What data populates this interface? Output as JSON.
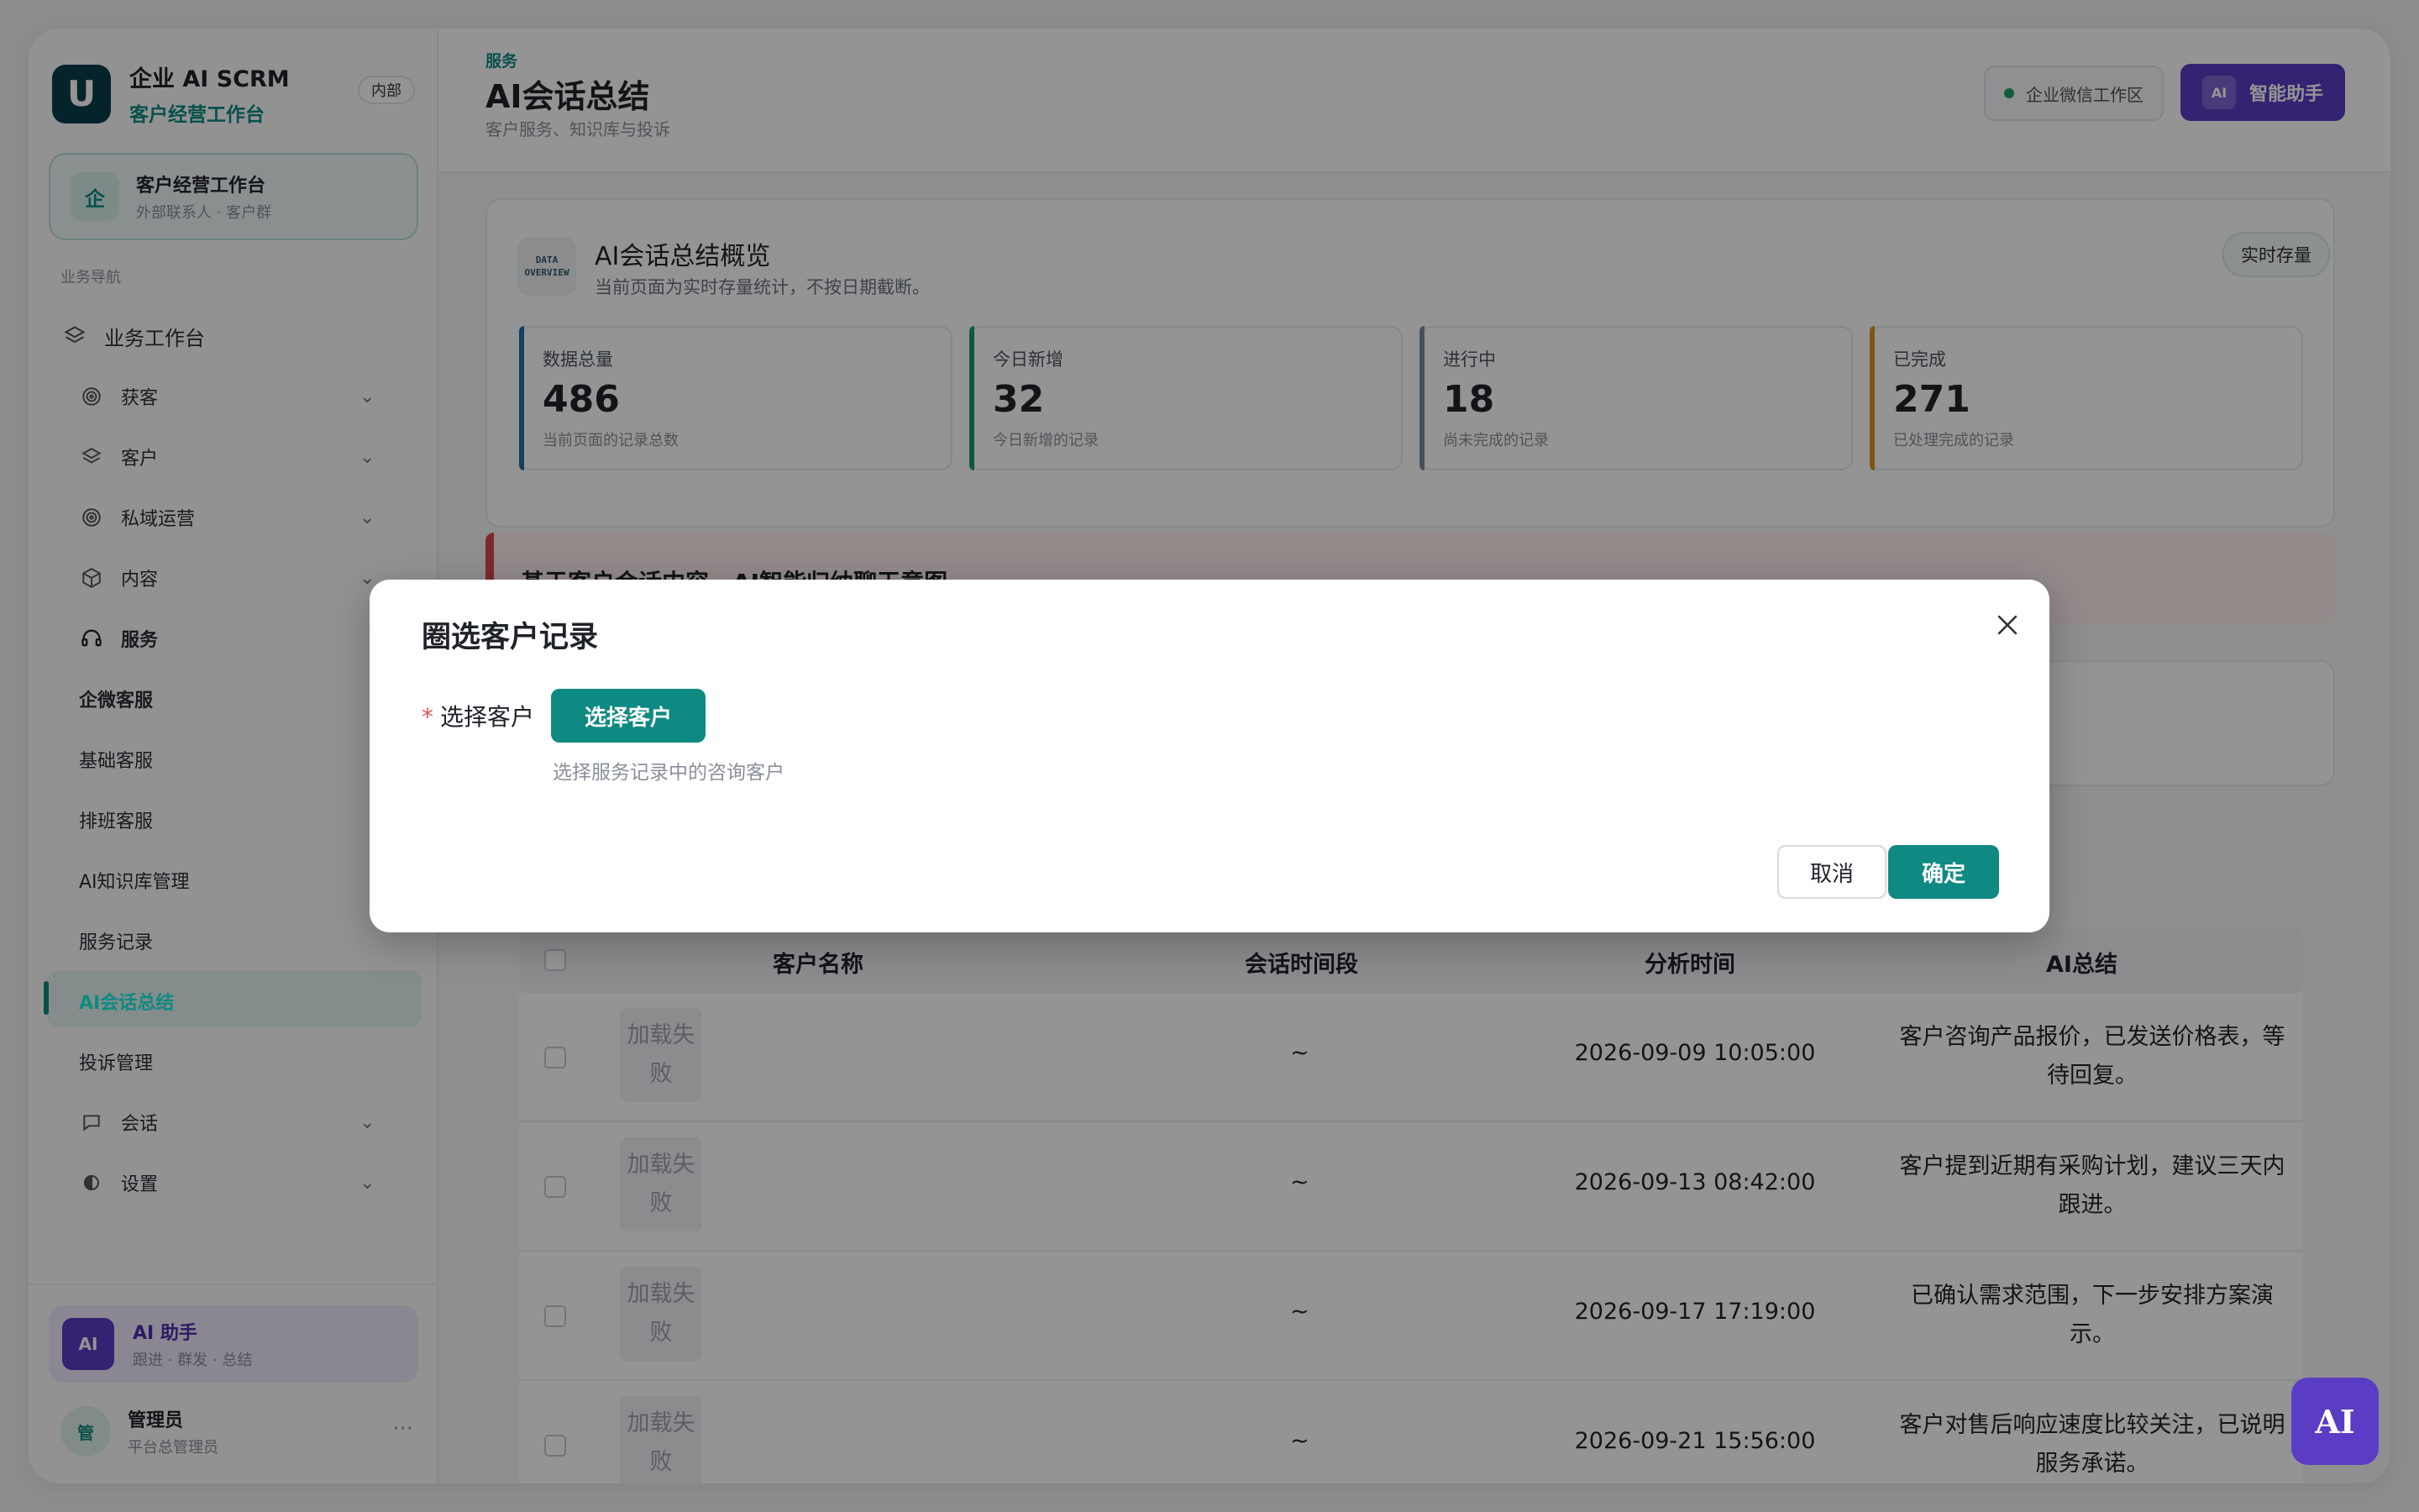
{
  "brand": {
    "title": "企业 AI SCRM",
    "subtitle": "客户经营工作台",
    "badge": "内部",
    "logo_letter": "U"
  },
  "workspace_card": {
    "icon_text": "企",
    "title": "客户经营工作台",
    "subtitle": "外部联系人 · 客户群"
  },
  "nav_caption": "业务导航",
  "nav": {
    "workbench": "业务工作台",
    "acquire": "获客",
    "customer": "客户",
    "private": "私域运营",
    "content": "内容",
    "service": "服务",
    "wecom_service": "企微客服",
    "basic_service": "基础客服",
    "schedule_service": "排班客服",
    "kb_manage": "AI知识库管理",
    "service_records": "服务记录",
    "ai_summary": "AI会话总结",
    "complaints": "投诉管理",
    "session": "会话",
    "settings": "设置"
  },
  "ai_card": {
    "avatar": "AI",
    "title": "AI 助手",
    "subtitle": "跟进 · 群发 · 总结"
  },
  "user": {
    "avatar": "管",
    "name": "管理员",
    "role": "平台总管理员",
    "more": "···"
  },
  "header": {
    "crumb": "服务",
    "title": "AI会话总结",
    "subtitle": "客户服务、知识库与投诉",
    "workspace_pill": "企业微信工作区",
    "assistant_label": "智能助手",
    "assistant_badge": "AI"
  },
  "overview": {
    "icon_line1": "DATA",
    "icon_line2": "OVERVIEW",
    "title": "AI会话总结概览",
    "subtitle": "当前页面为实时存量统计，不按日期截断。",
    "pill": "实时存量",
    "stats": [
      {
        "label": "数据总量",
        "value": "486",
        "note": "当前页面的记录总数",
        "color": "#1f6fa8"
      },
      {
        "label": "今日新增",
        "value": "32",
        "note": "今日新增的记录",
        "color": "#169c6b"
      },
      {
        "label": "进行中",
        "value": "18",
        "note": "尚未完成的记录",
        "color": "#7b8794"
      },
      {
        "label": "已完成",
        "value": "271",
        "note": "已处理完成的记录",
        "color": "#d99423"
      }
    ]
  },
  "alert": {
    "text": "基于客户会话内容，AI智能归纳聊天意图"
  },
  "table": {
    "headers": {
      "name": "客户名称",
      "period": "会话时间段",
      "time": "分析时间",
      "summary": "AI总结"
    },
    "rows": [
      {
        "name": "加载失败",
        "period": "~",
        "time": "2026-09-09 10:05:00",
        "summary": "客户咨询产品报价，已发送价格表，等待回复。"
      },
      {
        "name": "加载失败",
        "period": "~",
        "time": "2026-09-13 08:42:00",
        "summary": "客户提到近期有采购计划，建议三天内跟进。"
      },
      {
        "name": "加载失败",
        "period": "~",
        "time": "2026-09-17 17:19:00",
        "summary": "已确认需求范围，下一步安排方案演示。"
      },
      {
        "name": "加载失败",
        "period": "~",
        "time": "2026-09-21 15:56:00",
        "summary": "客户对售后响应速度比较关注，已说明服务承诺。"
      }
    ]
  },
  "float_ai": "AI",
  "modal": {
    "title": "圈选客户记录",
    "required_mark": "*",
    "field_label": "选择客户",
    "select_button": "选择客户",
    "hint": "选择服务记录中的咨询客户",
    "cancel": "取消",
    "confirm": "确定"
  },
  "colors": {
    "accent": "#0e8a82",
    "purple": "#5b3cc4",
    "danger": "#d94848"
  },
  "icons": [
    "layers-icon",
    "target-icon",
    "stack-icon",
    "box-icon",
    "headset-icon",
    "chat-icon",
    "settings-icon",
    "chevron-down-icon",
    "close-icon"
  ]
}
